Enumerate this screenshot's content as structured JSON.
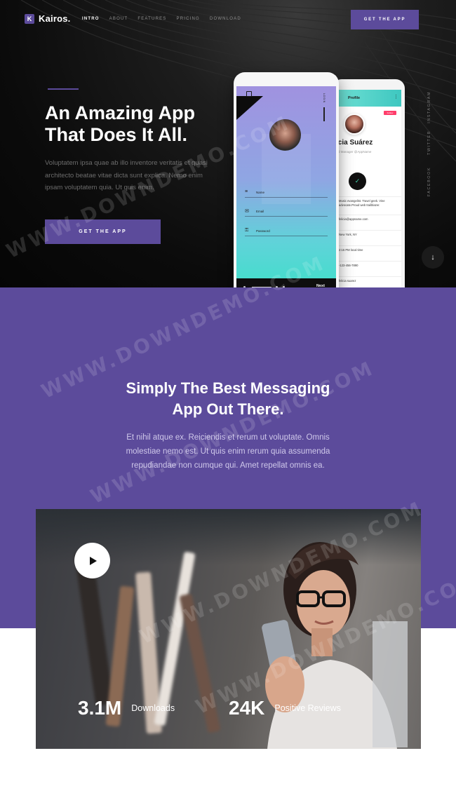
{
  "brand": {
    "logo_letter": "K",
    "name": "Kairos."
  },
  "nav": {
    "items": [
      {
        "label": "INTRO",
        "active": true
      },
      {
        "label": "ABOUT",
        "active": false
      },
      {
        "label": "FEATURES",
        "active": false
      },
      {
        "label": "PRICING",
        "active": false
      },
      {
        "label": "DOWNLOAD",
        "active": false
      }
    ],
    "cta_label": "GET THE APP"
  },
  "hero": {
    "title_line1": "An Amazing App",
    "title_line2": "That Does It All.",
    "text": "Voluptatem ipsa quae ab illo inventore veritatis et quasi architecto beatae vitae dicta sunt explica. Nemo enim ipsam voluptatem quia. Ut quis enim.",
    "cta_label": "GET THE APP"
  },
  "social": [
    "FACEBOOK",
    "TWITTER",
    "INSTAGRAM"
  ],
  "scroll_icon": "↓",
  "phone_profile": {
    "header": "Profile",
    "badge": "Follow",
    "name": "icia Suárez",
    "subtitle": "d Manager @AppName",
    "check_icon": "✓",
    "rows": [
      "Music evangelist. Travel geek. Vine advocate.Proud web trailblazer.",
      "felicia@appname.com",
      "New York, NY",
      "2:15 PM local time",
      "-123-456-7890",
      "felicia suarez"
    ]
  },
  "phone_login": {
    "side_label": "LOGIN",
    "fields": [
      {
        "icon": "≡",
        "label": "Name"
      },
      {
        "icon": "✉",
        "label": "Email"
      },
      {
        "icon": "⚿",
        "label": "Password"
      }
    ],
    "next_label": "Next"
  },
  "section": {
    "title_line1": "Simply The Best Messaging",
    "title_line2": "App Out There.",
    "text": "Et nihil atque ex. Reiciendis et rerum ut voluptate. Omnis molestiae nemo est. Ut quis enim rerum quia assumenda repudiandae non cumque qui. Amet repellat omnis ea."
  },
  "stats": [
    {
      "value": "3.1M",
      "label": "Downloads"
    },
    {
      "value": "24K",
      "label": "Positive Reviews"
    }
  ],
  "watermark": "WWW.DOWNDEMO.COM",
  "colors": {
    "accent": "#5c4b9b",
    "hero_bg": "#0b0b0b",
    "teal": "#3de0c8"
  }
}
